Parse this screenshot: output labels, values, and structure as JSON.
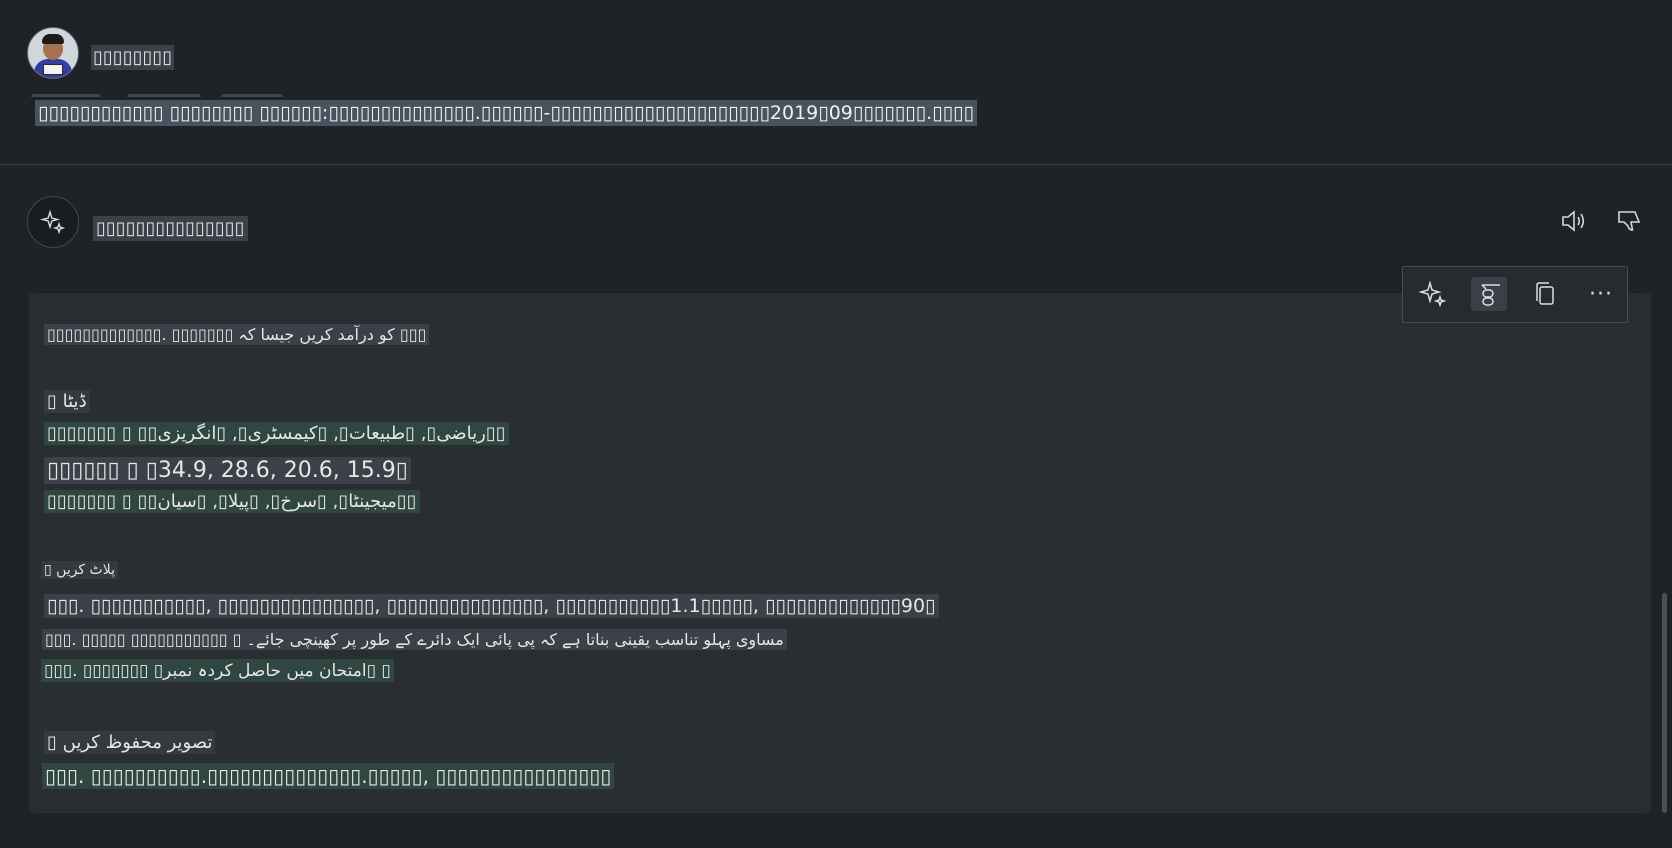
{
  "user": {
    "name": "▯▯▯▯▯▯▯▯",
    "prompt": "▯▯▯▯▯▯▯▯▯▯▯▯ ▯▯▯▯▯▯▯▯ ▯▯▯▯▯▯:▯▯▯▯▯▯▯▯▯▯▯▯▯▯.▯▯▯▯▯▯-▯▯▯▯▯▯▯▯▯▯▯▯▯▯▯▯▯▯▯▯▯2019▯09▯▯▯▯▯▯▯.▯▯▯▯"
  },
  "assistant": {
    "name": "▯▯▯▯▯▯▯▯▯▯▯▯▯▯▯"
  },
  "toolbar": {
    "icons": [
      "sparkle-icon",
      "copilot-compose-icon",
      "copy-icon",
      "more-icon"
    ],
    "more_label": "···"
  },
  "response": {
    "intro": "▯▯▯▯▯▯▯▯▯▯▯▯▯. ▯▯▯▯▯▯▯ کو درآمد کریں جیسا کہ ▯▯▯",
    "data_heading": "▯ ڈیٹا",
    "data_subjects": "▯▯▯▯▯▯▯ ▯ ▯▯ریاضی▯, ▯طبیعات▯, ▯کیمسٹری▯, ▯انگریزی▯▯",
    "data_values": "▯▯▯▯▯▯ ▯ ▯34.9, 28.6, 20.6, 15.9▯",
    "data_colors": "▯▯▯▯▯▯▯ ▯ ▯▯میجینٹا▯, ▯سرخ▯, ▯پیلا▯, ▯سیان▯▯",
    "plot_heading": "▯ پلاٹ کریں",
    "plot_line1": "▯▯▯. ▯▯▯▯▯▯▯▯▯▯▯, ▯▯▯▯▯▯▯▯▯▯▯▯▯▯▯, ▯▯▯▯▯▯▯▯▯▯▯▯▯▯▯, ▯▯▯▯▯▯▯▯▯▯▯1.1▯▯▯▯▯, ▯▯▯▯▯▯▯▯▯▯▯▯▯90▯",
    "plot_line2": "▯▯▯. ▯▯▯▯▯ ▯▯▯▯▯▯▯▯▯▯▯ ▯ مساوی پہلو تناسب یقینی بناتا ہے کہ پی پائی ایک دائرے کے طور پر کھینچی جائے۔",
    "plot_line3": "▯▯▯. ▯▯▯▯▯▯▯ ▯امتحان میں حاصل کردہ نمبر▯ ▯",
    "save_heading": "▯ تصویر محفوظ کریں",
    "save_line": "▯▯▯. ▯▯▯▯▯▯▯▯▯▯.▯▯▯▯▯▯▯▯▯▯▯▯▯▯.▯▯▯▯▯, ▯▯▯▯▯▯▯▯▯▯▯▯▯▯▯▯"
  }
}
